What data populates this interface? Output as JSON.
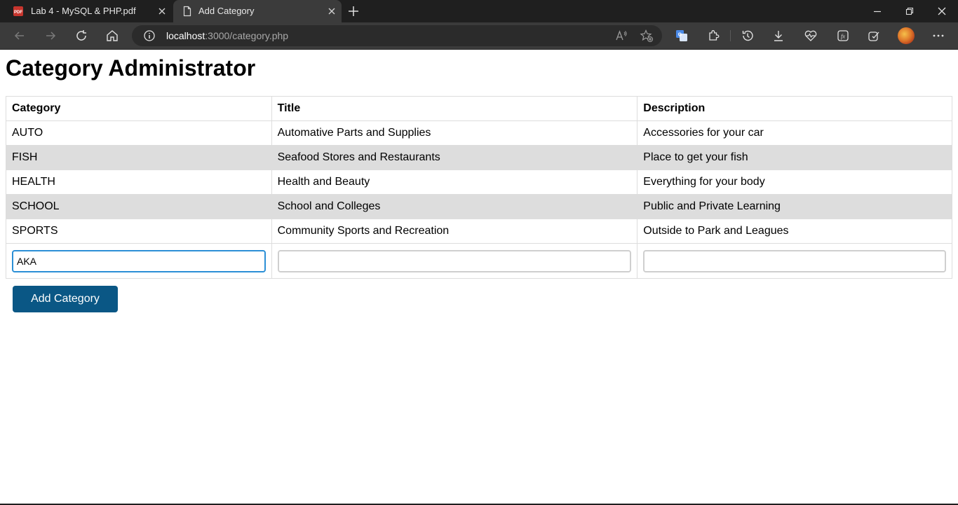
{
  "browser": {
    "tabs": [
      {
        "title": "Lab 4 - MySQL & PHP.pdf",
        "icon": "pdf-icon",
        "active": false
      },
      {
        "title": "Add Category",
        "icon": "page-icon",
        "active": true
      }
    ],
    "address": {
      "host": "localhost",
      "rest": ":3000/category.php"
    }
  },
  "page": {
    "title": "Category Administrator",
    "table": {
      "headers": [
        "Category",
        "Title",
        "Description"
      ],
      "rows": [
        [
          "AUTO",
          "Automative Parts and Supplies",
          "Accessories for your car"
        ],
        [
          "FISH",
          "Seafood Stores and Restaurants",
          "Place to get your fish"
        ],
        [
          "HEALTH",
          "Health and Beauty",
          "Everything for your body"
        ],
        [
          "SCHOOL",
          "School and Colleges",
          "Public and Private Learning"
        ],
        [
          "SPORTS",
          "Community Sports and Recreation",
          "Outside to Park and Leagues"
        ]
      ]
    },
    "form": {
      "category_value": "AKA",
      "title_value": "",
      "description_value": "",
      "submit_label": "Add Category"
    }
  },
  "colors": {
    "button": "#0a5785",
    "stripe": "#dddddd",
    "focus": "#2b8fd6"
  }
}
